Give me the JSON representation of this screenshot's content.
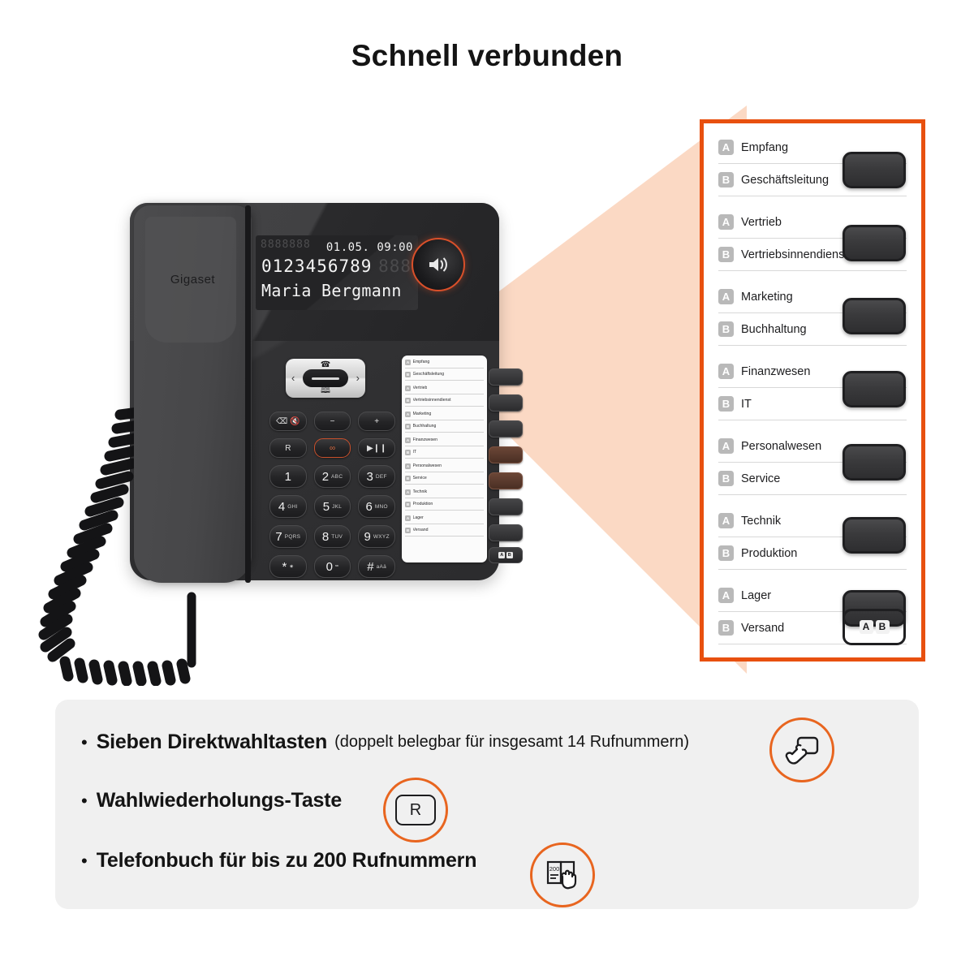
{
  "title": "Schnell verbunden",
  "brand": "Gigaset",
  "colors": {
    "accent_orange": "#e8500f",
    "icon_orange": "#e8651f",
    "card_bg": "#f0f0f0",
    "beam": "#fbd9c4",
    "phone_body": "#3b3b3d",
    "badge_gray": "#b9b9b9"
  },
  "display": {
    "ghost_icons": "8888888",
    "date_time": "01.05. 09:00",
    "number": "0123456789",
    "number_ghost": "888",
    "name": "Maria Bergmann"
  },
  "navpad": {
    "up_icon": "handset-icon",
    "down_icon": "phonebook-icon",
    "left_icon": "‹",
    "right_icon": "›"
  },
  "keypad": {
    "rows": [
      [
        {
          "name": "delete-mute-key",
          "glyph": "⌧ ⊘",
          "sub": ""
        },
        {
          "name": "volume-down-key",
          "glyph": "–",
          "sub": ""
        },
        {
          "name": "volume-up-key",
          "glyph": "+",
          "sub": ""
        }
      ],
      [
        {
          "name": "redial-key",
          "glyph": "R",
          "sub": ""
        },
        {
          "name": "answering-machine-key",
          "glyph": "∞",
          "sub": ""
        },
        {
          "name": "play-pause-key",
          "glyph": "▶❙❙",
          "sub": ""
        }
      ]
    ],
    "digits": [
      [
        {
          "d": "1",
          "sub": ""
        },
        {
          "d": "2",
          "sub": "ABC"
        },
        {
          "d": "3",
          "sub": "DEF"
        }
      ],
      [
        {
          "d": "4",
          "sub": "GHI"
        },
        {
          "d": "5",
          "sub": "JKL"
        },
        {
          "d": "6",
          "sub": "MNO"
        }
      ],
      [
        {
          "d": "7",
          "sub": "PQRS"
        },
        {
          "d": "8",
          "sub": "TUV"
        },
        {
          "d": "9",
          "sub": "WXYZ"
        }
      ],
      [
        {
          "d": "*",
          "sub": "✷"
        },
        {
          "d": "0",
          "sub": "⌴"
        },
        {
          "d": "#",
          "sub": "aAä"
        }
      ]
    ]
  },
  "speed_dial": {
    "badge_a": "A",
    "badge_b": "B",
    "shift_button": {
      "a": "A",
      "b": "B"
    },
    "groups": [
      {
        "a": "Empfang",
        "b": "Geschäftsleitung"
      },
      {
        "a": "Vertrieb",
        "b": "Vertriebsinnendienst"
      },
      {
        "a": "Marketing",
        "b": "Buchhaltung"
      },
      {
        "a": "Finanzwesen",
        "b": "IT"
      },
      {
        "a": "Personalwesen",
        "b": "Service"
      },
      {
        "a": "Technik",
        "b": "Produktion"
      },
      {
        "a": "Lager",
        "b": "Versand"
      }
    ]
  },
  "features": [
    {
      "bullet": "•",
      "text": "Sieben Direktwahltasten",
      "sub": "(doppelt belegbar für insgesamt 14 Rufnummern)",
      "icon": "hand-press-button-icon"
    },
    {
      "bullet": "•",
      "text": "Wahlwiederholungs-Taste",
      "sub": "",
      "icon": "r-key-icon",
      "icon_label": "R"
    },
    {
      "bullet": "•",
      "text": "Telefonbuch für bis zu 200 Rufnummern",
      "sub": "",
      "icon": "phonebook-hand-icon",
      "icon_label": "200"
    }
  ]
}
